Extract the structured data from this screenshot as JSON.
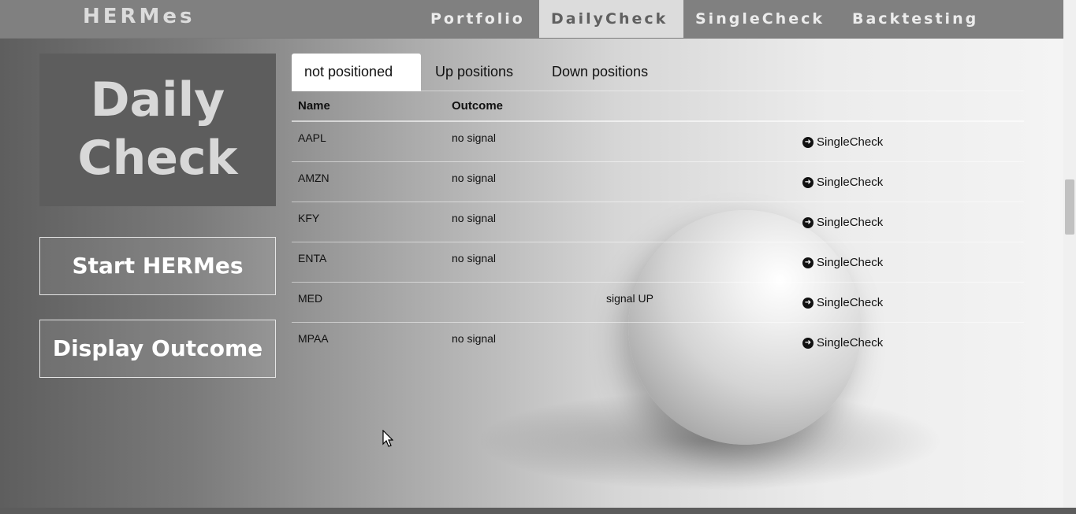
{
  "navbar": {
    "brand": "HERMes",
    "items": [
      {
        "label": "Portfolio"
      },
      {
        "label": "DailyCheck"
      },
      {
        "label": "SingleCheck"
      },
      {
        "label": "Backtesting"
      }
    ],
    "active": "DailyCheck"
  },
  "sidebar": {
    "title_line1": "Daily",
    "title_line2": "Check",
    "start_button": "Start HERMes",
    "display_button": "Display Outcome"
  },
  "tabs": [
    {
      "label": "not positioned"
    },
    {
      "label": "Up positions"
    },
    {
      "label": "Down positions"
    }
  ],
  "table": {
    "headers": {
      "name": "Name",
      "outcome": "Outcome"
    },
    "rows": [
      {
        "name": "AAPL",
        "outcome": "no signal",
        "action": "SingleCheck"
      },
      {
        "name": "AMZN",
        "outcome": "no signal",
        "action": "SingleCheck"
      },
      {
        "name": "KFY",
        "outcome": "no signal",
        "action": "SingleCheck"
      },
      {
        "name": "ENTA",
        "outcome": "no signal",
        "action": "SingleCheck"
      },
      {
        "name": "MED",
        "outcome": "signal UP",
        "action": "SingleCheck"
      },
      {
        "name": "MPAA",
        "outcome": "no signal",
        "action": "SingleCheck"
      }
    ]
  },
  "icons": {
    "link_icon": "arrow-circle-right-icon"
  },
  "colors": {
    "navbar_bg": "#808080",
    "active_nav_bg": "#dcdcdc",
    "title_box_bg": "#5d5d5d"
  }
}
